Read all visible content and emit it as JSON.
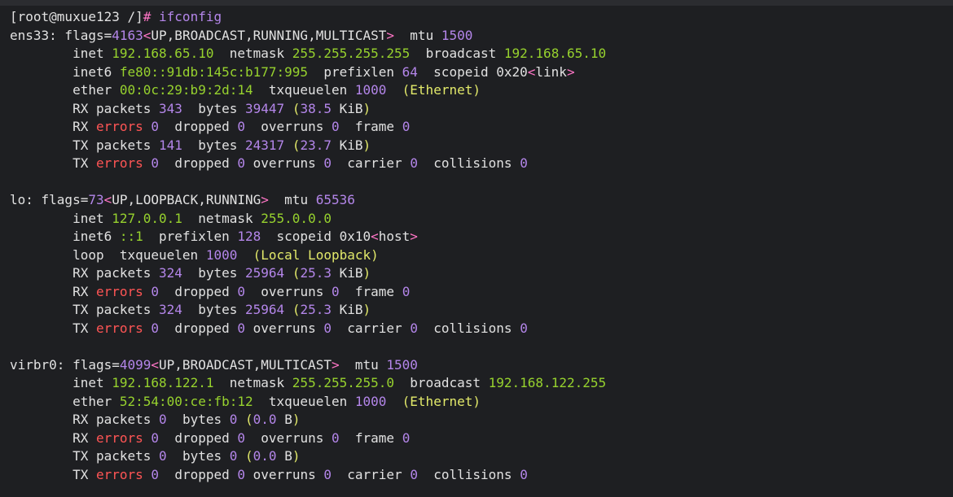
{
  "terminal": {
    "colors": {
      "background": "#1e1f22",
      "text": "#e1e1e1",
      "green": "#97d22e",
      "purple": "#b486ea",
      "red": "#ff5555",
      "yellow": "#e2e96a",
      "pink": "#ff75c6"
    },
    "lines": [
      [
        {
          "t": "[root@muxue123 /]"
        },
        {
          "t": "# ",
          "c": "pink"
        },
        {
          "t": "ifconfig",
          "c": "purple"
        }
      ],
      [
        {
          "t": "ens33: flags="
        },
        {
          "t": "4163",
          "c": "purple"
        },
        {
          "t": "<",
          "c": "pink"
        },
        {
          "t": "UP,BROADCAST,RUNNING,MULTICAST"
        },
        {
          "t": ">",
          "c": "pink"
        },
        {
          "t": "  mtu "
        },
        {
          "t": "1500",
          "c": "purple"
        }
      ],
      [
        {
          "t": "        inet "
        },
        {
          "t": "192.168.65.10",
          "c": "green"
        },
        {
          "t": "  netmask "
        },
        {
          "t": "255.255.255.255",
          "c": "green"
        },
        {
          "t": "  broadcast "
        },
        {
          "t": "192.168.65.10",
          "c": "green"
        }
      ],
      [
        {
          "t": "        inet6 "
        },
        {
          "t": "fe80::91db:145c:b177:995",
          "c": "green"
        },
        {
          "t": "  prefixlen "
        },
        {
          "t": "64",
          "c": "purple"
        },
        {
          "t": "  scopeid 0x20"
        },
        {
          "t": "<",
          "c": "pink"
        },
        {
          "t": "link"
        },
        {
          "t": ">",
          "c": "pink"
        }
      ],
      [
        {
          "t": "        ether "
        },
        {
          "t": "00:0c:29:b9:2d:14",
          "c": "green"
        },
        {
          "t": "  txqueuelen "
        },
        {
          "t": "1000",
          "c": "purple"
        },
        {
          "t": "  "
        },
        {
          "t": "(Ethernet)",
          "c": "yellow"
        }
      ],
      [
        {
          "t": "        RX packets "
        },
        {
          "t": "343",
          "c": "purple"
        },
        {
          "t": "  bytes "
        },
        {
          "t": "39447",
          "c": "purple"
        },
        {
          "t": " "
        },
        {
          "t": "(",
          "c": "yellow"
        },
        {
          "t": "38.5",
          "c": "purple"
        },
        {
          "t": " KiB"
        },
        {
          "t": ")",
          "c": "yellow"
        }
      ],
      [
        {
          "t": "        RX "
        },
        {
          "t": "errors",
          "c": "red"
        },
        {
          "t": " "
        },
        {
          "t": "0",
          "c": "purple"
        },
        {
          "t": "  dropped "
        },
        {
          "t": "0",
          "c": "purple"
        },
        {
          "t": "  overruns "
        },
        {
          "t": "0",
          "c": "purple"
        },
        {
          "t": "  frame "
        },
        {
          "t": "0",
          "c": "purple"
        }
      ],
      [
        {
          "t": "        TX packets "
        },
        {
          "t": "141",
          "c": "purple"
        },
        {
          "t": "  bytes "
        },
        {
          "t": "24317",
          "c": "purple"
        },
        {
          "t": " "
        },
        {
          "t": "(",
          "c": "yellow"
        },
        {
          "t": "23.7",
          "c": "purple"
        },
        {
          "t": " KiB"
        },
        {
          "t": ")",
          "c": "yellow"
        }
      ],
      [
        {
          "t": "        TX "
        },
        {
          "t": "errors",
          "c": "red"
        },
        {
          "t": " "
        },
        {
          "t": "0",
          "c": "purple"
        },
        {
          "t": "  dropped "
        },
        {
          "t": "0",
          "c": "purple"
        },
        {
          "t": " overruns "
        },
        {
          "t": "0",
          "c": "purple"
        },
        {
          "t": "  carrier "
        },
        {
          "t": "0",
          "c": "purple"
        },
        {
          "t": "  collisions "
        },
        {
          "t": "0",
          "c": "purple"
        }
      ],
      [],
      [
        {
          "t": "lo: flags="
        },
        {
          "t": "73",
          "c": "purple"
        },
        {
          "t": "<",
          "c": "pink"
        },
        {
          "t": "UP,LOOPBACK,RUNNING"
        },
        {
          "t": ">",
          "c": "pink"
        },
        {
          "t": "  mtu "
        },
        {
          "t": "65536",
          "c": "purple"
        }
      ],
      [
        {
          "t": "        inet "
        },
        {
          "t": "127.0.0.1",
          "c": "green"
        },
        {
          "t": "  netmask "
        },
        {
          "t": "255.0.0.0",
          "c": "green"
        }
      ],
      [
        {
          "t": "        inet6 "
        },
        {
          "t": "::1",
          "c": "green"
        },
        {
          "t": "  prefixlen "
        },
        {
          "t": "128",
          "c": "purple"
        },
        {
          "t": "  scopeid 0x10"
        },
        {
          "t": "<",
          "c": "pink"
        },
        {
          "t": "host"
        },
        {
          "t": ">",
          "c": "pink"
        }
      ],
      [
        {
          "t": "        loop  txqueuelen "
        },
        {
          "t": "1000",
          "c": "purple"
        },
        {
          "t": "  "
        },
        {
          "t": "(Local Loopback)",
          "c": "yellow"
        }
      ],
      [
        {
          "t": "        RX packets "
        },
        {
          "t": "324",
          "c": "purple"
        },
        {
          "t": "  bytes "
        },
        {
          "t": "25964",
          "c": "purple"
        },
        {
          "t": " "
        },
        {
          "t": "(",
          "c": "yellow"
        },
        {
          "t": "25.3",
          "c": "purple"
        },
        {
          "t": " KiB"
        },
        {
          "t": ")",
          "c": "yellow"
        }
      ],
      [
        {
          "t": "        RX "
        },
        {
          "t": "errors",
          "c": "red"
        },
        {
          "t": " "
        },
        {
          "t": "0",
          "c": "purple"
        },
        {
          "t": "  dropped "
        },
        {
          "t": "0",
          "c": "purple"
        },
        {
          "t": "  overruns "
        },
        {
          "t": "0",
          "c": "purple"
        },
        {
          "t": "  frame "
        },
        {
          "t": "0",
          "c": "purple"
        }
      ],
      [
        {
          "t": "        TX packets "
        },
        {
          "t": "324",
          "c": "purple"
        },
        {
          "t": "  bytes "
        },
        {
          "t": "25964",
          "c": "purple"
        },
        {
          "t": " "
        },
        {
          "t": "(",
          "c": "yellow"
        },
        {
          "t": "25.3",
          "c": "purple"
        },
        {
          "t": " KiB"
        },
        {
          "t": ")",
          "c": "yellow"
        }
      ],
      [
        {
          "t": "        TX "
        },
        {
          "t": "errors",
          "c": "red"
        },
        {
          "t": " "
        },
        {
          "t": "0",
          "c": "purple"
        },
        {
          "t": "  dropped "
        },
        {
          "t": "0",
          "c": "purple"
        },
        {
          "t": " overruns "
        },
        {
          "t": "0",
          "c": "purple"
        },
        {
          "t": "  carrier "
        },
        {
          "t": "0",
          "c": "purple"
        },
        {
          "t": "  collisions "
        },
        {
          "t": "0",
          "c": "purple"
        }
      ],
      [],
      [
        {
          "t": "virbr0: flags="
        },
        {
          "t": "4099",
          "c": "purple"
        },
        {
          "t": "<",
          "c": "pink"
        },
        {
          "t": "UP,BROADCAST,MULTICAST"
        },
        {
          "t": ">",
          "c": "pink"
        },
        {
          "t": "  mtu "
        },
        {
          "t": "1500",
          "c": "purple"
        }
      ],
      [
        {
          "t": "        inet "
        },
        {
          "t": "192.168.122.1",
          "c": "green"
        },
        {
          "t": "  netmask "
        },
        {
          "t": "255.255.255.0",
          "c": "green"
        },
        {
          "t": "  broadcast "
        },
        {
          "t": "192.168.122.255",
          "c": "green"
        }
      ],
      [
        {
          "t": "        ether "
        },
        {
          "t": "52:54:00:ce:fb:12",
          "c": "green"
        },
        {
          "t": "  txqueuelen "
        },
        {
          "t": "1000",
          "c": "purple"
        },
        {
          "t": "  "
        },
        {
          "t": "(Ethernet)",
          "c": "yellow"
        }
      ],
      [
        {
          "t": "        RX packets "
        },
        {
          "t": "0",
          "c": "purple"
        },
        {
          "t": "  bytes "
        },
        {
          "t": "0",
          "c": "purple"
        },
        {
          "t": " "
        },
        {
          "t": "(",
          "c": "yellow"
        },
        {
          "t": "0.0",
          "c": "purple"
        },
        {
          "t": " B"
        },
        {
          "t": ")",
          "c": "yellow"
        }
      ],
      [
        {
          "t": "        RX "
        },
        {
          "t": "errors",
          "c": "red"
        },
        {
          "t": " "
        },
        {
          "t": "0",
          "c": "purple"
        },
        {
          "t": "  dropped "
        },
        {
          "t": "0",
          "c": "purple"
        },
        {
          "t": "  overruns "
        },
        {
          "t": "0",
          "c": "purple"
        },
        {
          "t": "  frame "
        },
        {
          "t": "0",
          "c": "purple"
        }
      ],
      [
        {
          "t": "        TX packets "
        },
        {
          "t": "0",
          "c": "purple"
        },
        {
          "t": "  bytes "
        },
        {
          "t": "0",
          "c": "purple"
        },
        {
          "t": " "
        },
        {
          "t": "(",
          "c": "yellow"
        },
        {
          "t": "0.0",
          "c": "purple"
        },
        {
          "t": " B"
        },
        {
          "t": ")",
          "c": "yellow"
        }
      ],
      [
        {
          "t": "        TX "
        },
        {
          "t": "errors",
          "c": "red"
        },
        {
          "t": " "
        },
        {
          "t": "0",
          "c": "purple"
        },
        {
          "t": "  dropped "
        },
        {
          "t": "0",
          "c": "purple"
        },
        {
          "t": " overruns "
        },
        {
          "t": "0",
          "c": "purple"
        },
        {
          "t": "  carrier "
        },
        {
          "t": "0",
          "c": "purple"
        },
        {
          "t": "  collisions "
        },
        {
          "t": "0",
          "c": "purple"
        }
      ]
    ]
  }
}
